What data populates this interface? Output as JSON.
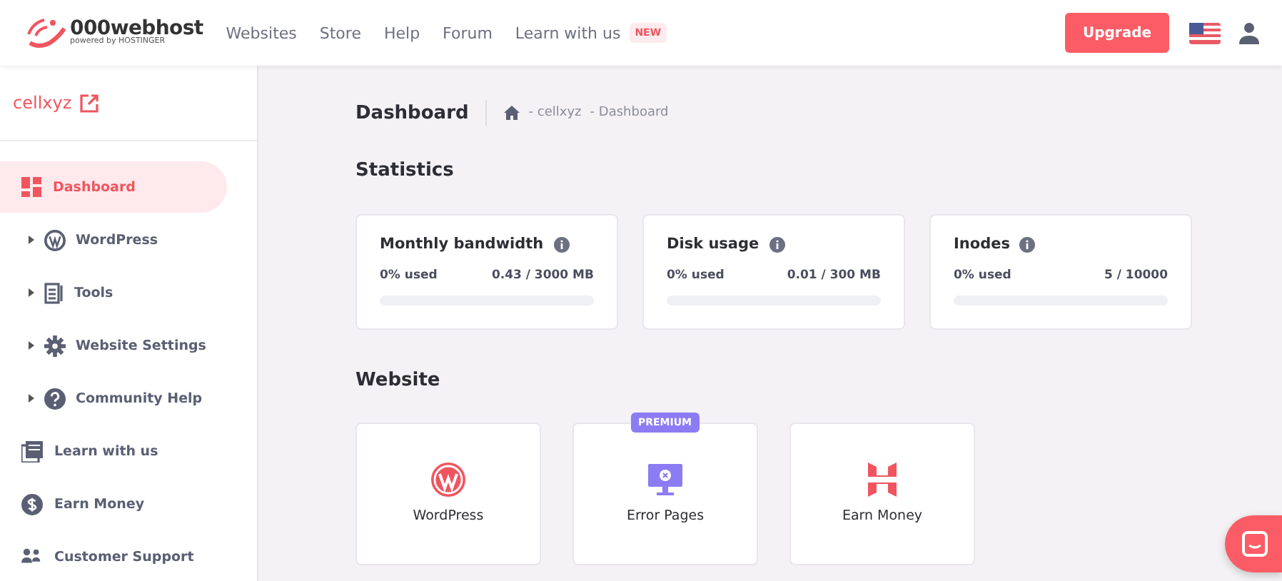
{
  "header": {
    "logo": {
      "name": "000webhost",
      "tagline": "powered by HOSTINGER"
    },
    "nav": [
      {
        "label": "Websites"
      },
      {
        "label": "Store"
      },
      {
        "label": "Help"
      },
      {
        "label": "Forum"
      },
      {
        "label": "Learn with us",
        "badge": "NEW"
      }
    ],
    "upgrade_button": "Upgrade"
  },
  "sidebar": {
    "site": "cellxyz",
    "items": [
      {
        "label": "Dashboard",
        "selected": true,
        "expandable": false
      },
      {
        "label": "WordPress",
        "selected": false,
        "expandable": true
      },
      {
        "label": "Tools",
        "selected": false,
        "expandable": true
      },
      {
        "label": "Website Settings",
        "selected": false,
        "expandable": true
      },
      {
        "label": "Community Help",
        "selected": false,
        "expandable": true
      },
      {
        "label": "Learn with us",
        "selected": false,
        "expandable": false
      },
      {
        "label": "Earn Money",
        "selected": false,
        "expandable": false
      },
      {
        "label": "Customer Support",
        "selected": false,
        "expandable": false
      }
    ]
  },
  "page": {
    "title": "Dashboard",
    "breadcrumb": [
      "- cellxyz",
      "- Dashboard"
    ],
    "statistics": {
      "heading": "Statistics",
      "cards": [
        {
          "title": "Monthly bandwidth",
          "used": "0% used",
          "amount": "0.43 / 3000 MB"
        },
        {
          "title": "Disk usage",
          "used": "0% used",
          "amount": "0.01 / 300 MB"
        },
        {
          "title": "Inodes",
          "used": "0% used",
          "amount": "5 / 10000"
        }
      ]
    },
    "website": {
      "heading": "Website",
      "tiles": [
        {
          "label": "WordPress"
        },
        {
          "label": "Error Pages",
          "badge": "PREMIUM"
        },
        {
          "label": "Earn Money"
        }
      ]
    }
  }
}
